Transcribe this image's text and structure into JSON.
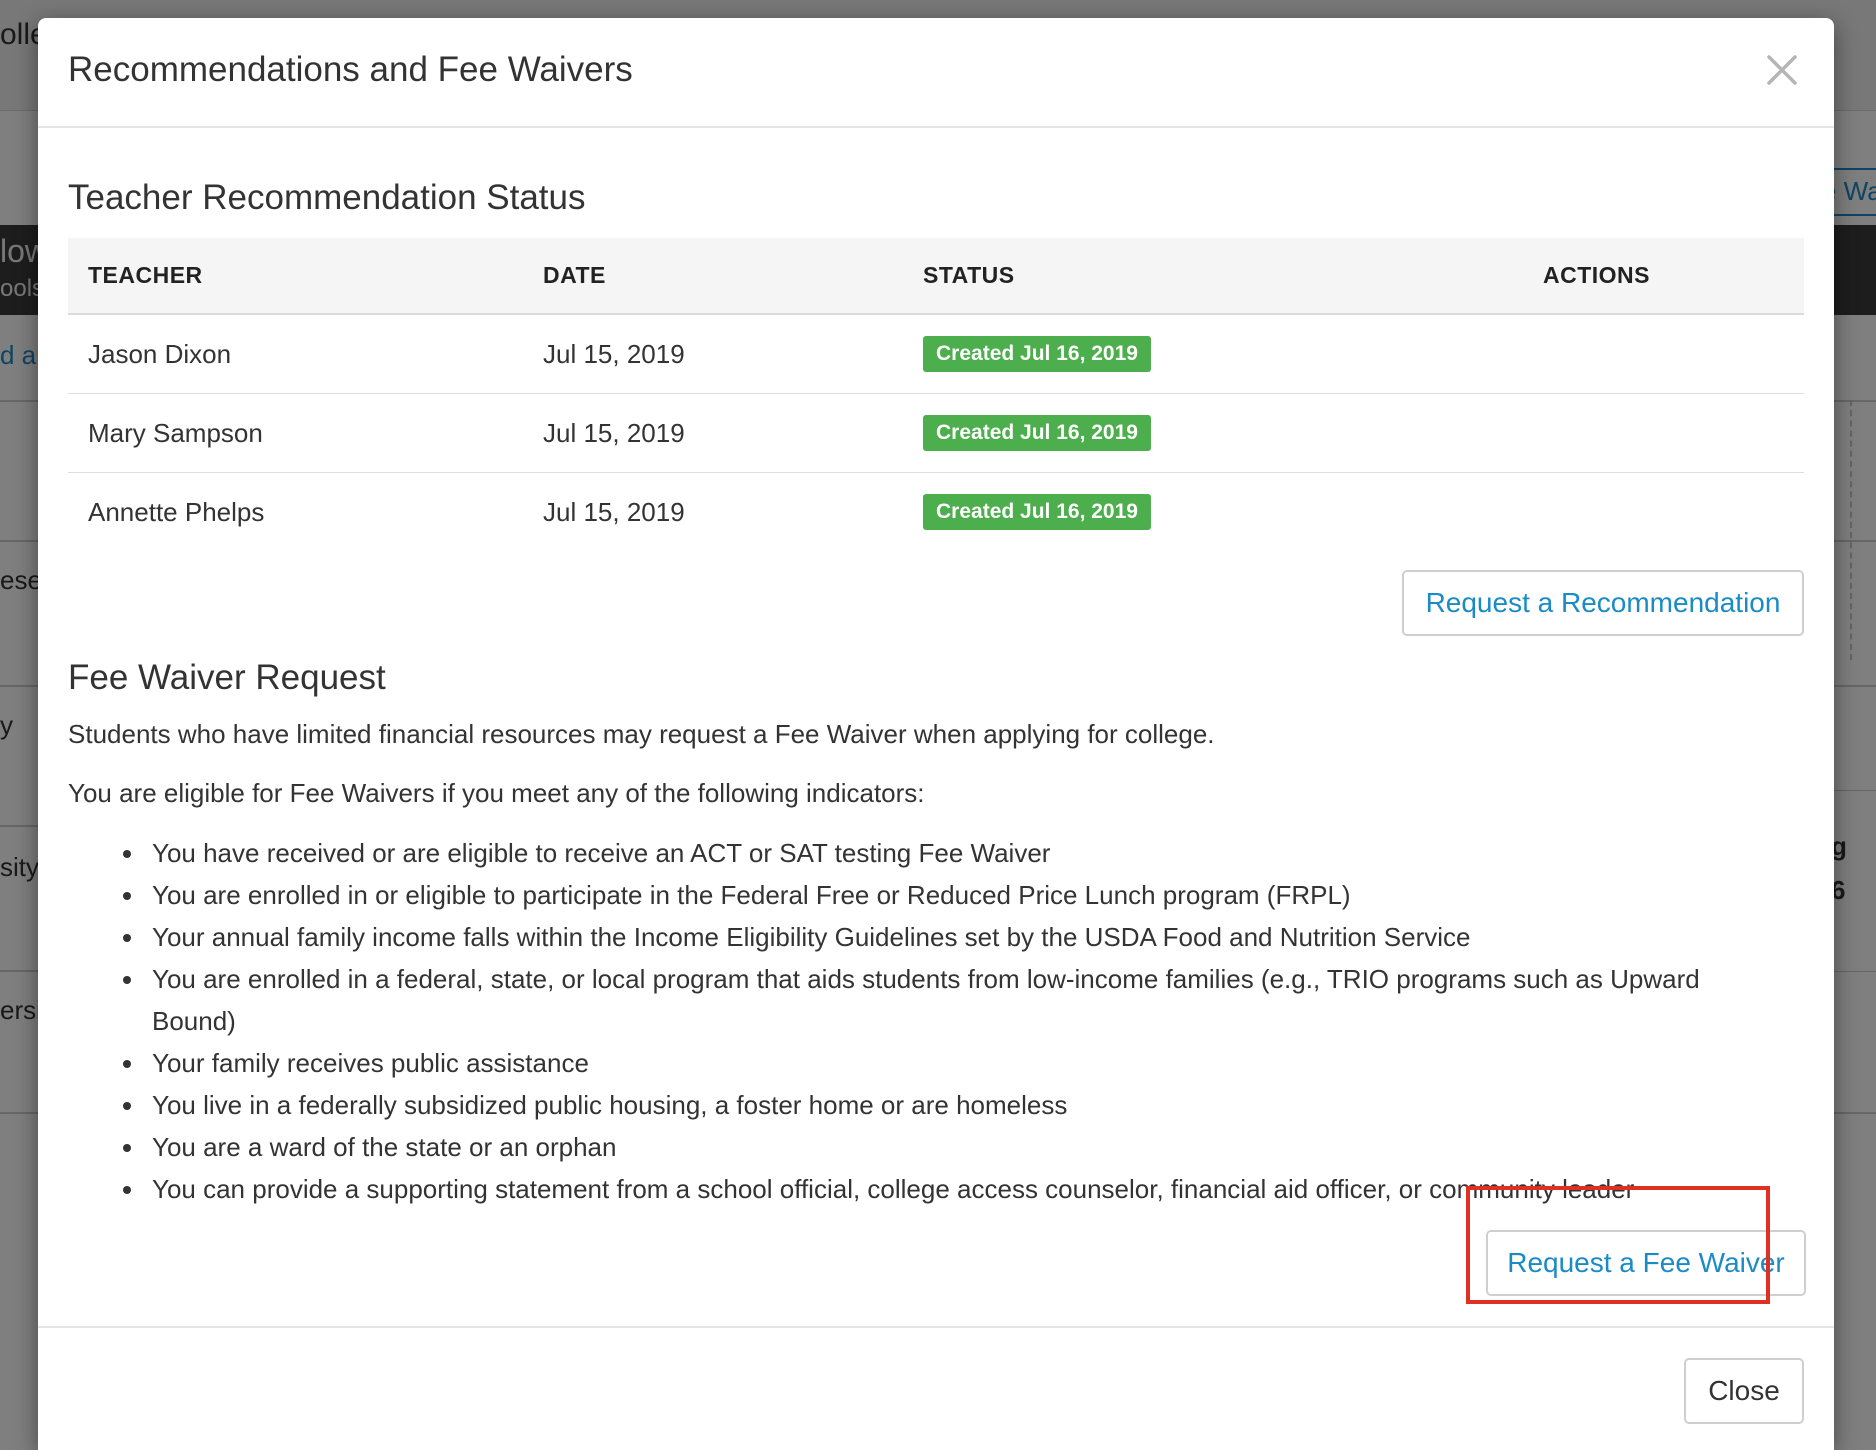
{
  "background": {
    "top_fragment": "olle",
    "band_fragment_1": "low",
    "band_fragment_2": "ools",
    "link_fragment": "d a",
    "row_fragment_1": "ese",
    "row_fragment_2": "y",
    "row_fragment_3": "sity",
    "row_fragment_4": "ersit",
    "right_button_fragment": "e Wa",
    "right_card_fragment_1": "g",
    "right_card_fragment_2": "6"
  },
  "modal": {
    "title": "Recommendations and Fee Waivers",
    "close_icon": "close-icon"
  },
  "recommendations": {
    "section_title": "Teacher Recommendation Status",
    "columns": [
      "TEACHER",
      "DATE",
      "STATUS",
      "ACTIONS"
    ],
    "rows": [
      {
        "teacher": "Jason Dixon",
        "date": "Jul 15, 2019",
        "status": "Created Jul 16, 2019"
      },
      {
        "teacher": "Mary Sampson",
        "date": "Jul 15, 2019",
        "status": "Created Jul 16, 2019"
      },
      {
        "teacher": "Annette Phelps",
        "date": "Jul 15, 2019",
        "status": "Created Jul 16, 2019"
      }
    ],
    "request_button_label": "Request a Recommendation"
  },
  "fee_waiver": {
    "section_title": "Fee Waiver Request",
    "intro": "Students who have limited financial resources may request a Fee Waiver when applying for college.",
    "eligibility_intro": "You are eligible for Fee Waivers if you meet any of the following indicators:",
    "indicators": [
      "You have received or are eligible to receive an ACT or SAT testing Fee Waiver",
      "You are enrolled in or eligible to participate in the Federal Free or Reduced Price Lunch program (FRPL)",
      "Your annual family income falls within the Income Eligibility Guidelines set by the USDA Food and Nutrition Service",
      "You are enrolled in a federal, state, or local program that aids students from low-income families (e.g., TRIO programs such as Upward Bound)",
      "Your family receives public assistance",
      "You live in a federally subsidized public housing, a foster home or are homeless",
      "You are a ward of the state or an orphan",
      "You can provide a supporting statement from a school official, college access counselor, financial aid officer, or community leader"
    ],
    "request_button_label": "Request a Fee Waiver",
    "highlight_color": "#e03024"
  },
  "footer": {
    "close_label": "Close"
  },
  "colors": {
    "accent": "#1b8bc6",
    "status_green": "#4cae4c"
  }
}
